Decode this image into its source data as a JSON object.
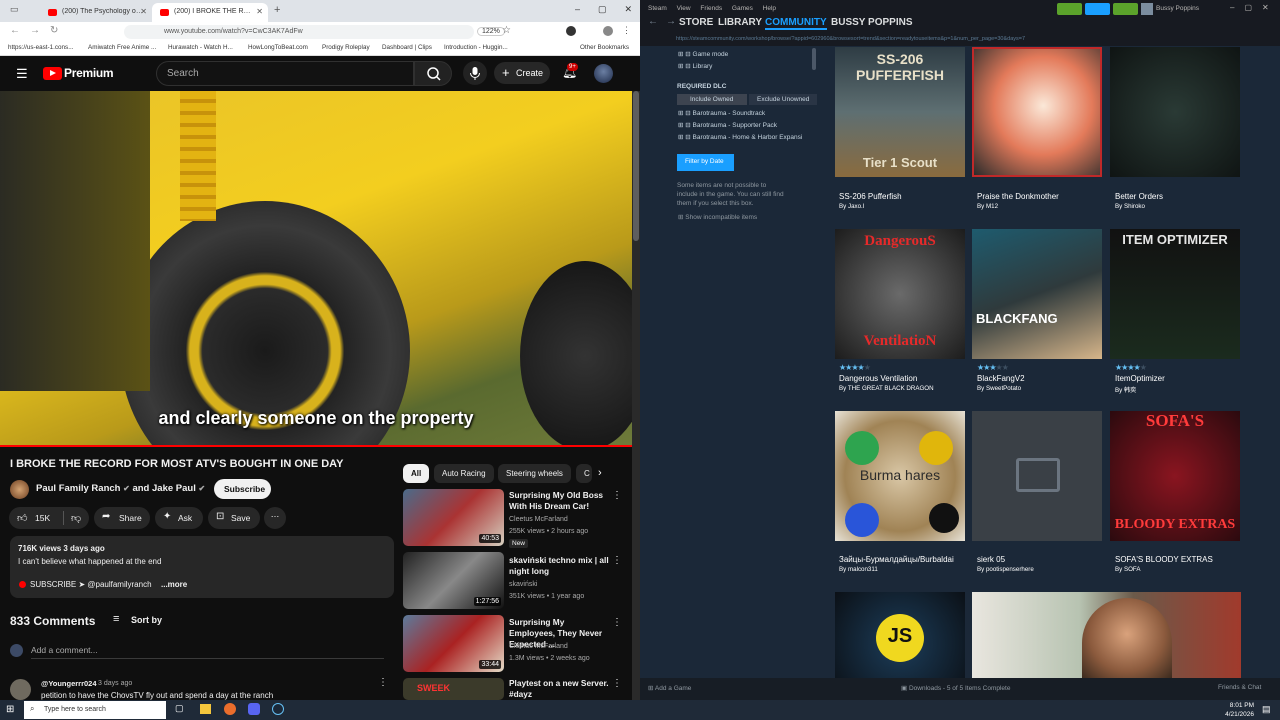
{
  "browser": {
    "tabs": [
      {
        "title": "(200) The Psychology of People"
      },
      {
        "title": "(200) I BROKE THE RECORD"
      }
    ],
    "url": "www.youtube.com/watch?v=CwC3AK7AdFw",
    "zoom": "122%",
    "bookmarks": [
      "https://us-east-1.cons...",
      "Amiwatch Free Anime ...",
      "Hurawatch - Watch H...",
      "HowLongToBeat.com",
      "Prodigy Roleplay",
      "Dashboard | Clips",
      "Introduction - Huggin...",
      "Other Bookmarks"
    ]
  },
  "youtube": {
    "logo": "Premium",
    "search_placeholder": "Search",
    "create_label": "Create",
    "notif_count": "9+",
    "caption": "and clearly someone on the property",
    "video_title": "I BROKE THE RECORD FOR MOST ATV'S BOUGHT IN ONE DAY",
    "channel": "Paul Family Ranch",
    "channel_and": "and",
    "channel2": "Jake Paul",
    "subscribe": "Subscribe",
    "likes": "15K",
    "share": "Share",
    "ask": "Ask",
    "save": "Save",
    "views": "716K views  3 days ago",
    "desc_line": "I can't believe what happened at the end",
    "desc_sub": "SUBSCRIBE ➤ @paulfamilyranch",
    "more": "...more",
    "comments_count": "833 Comments",
    "sort_by": "Sort by",
    "add_comment": "Add a comment...",
    "comment_user": "@Youngerrr024",
    "comment_time": "3 days ago",
    "comment_text": "petition to have the ChovsTV fly out and spend a day at the ranch",
    "chips": [
      "All",
      "Auto Racing",
      "Steering wheels",
      "C"
    ],
    "recs": [
      {
        "title": "Surprising My Old Boss With His Dream Car!",
        "channel": "Cleetus McFarland",
        "meta": "255K views • 2 hours ago",
        "badge": "New",
        "duration": "40:53"
      },
      {
        "title": "skaviński techno mix | all night long",
        "channel": "skaviński",
        "meta": "351K views • 1 year ago",
        "badge": "",
        "duration": "1:27:56"
      },
      {
        "title": "Surprising My Employees, They Never Expected ...",
        "channel": "Cleetus McFarland",
        "meta": "1.3M views • 2 weeks ago",
        "badge": "",
        "duration": "33:44"
      },
      {
        "title": "Playtest on a new Server. #dayz",
        "channel": "",
        "meta": "",
        "badge": "",
        "duration": ""
      }
    ],
    "rec4_thumb_text": "SWEEK"
  },
  "steam": {
    "menu": [
      "Steam",
      "View",
      "Friends",
      "Games",
      "Help"
    ],
    "nav": [
      "STORE",
      "LIBRARY",
      "COMMUNITY",
      "BUSSY POPPINS"
    ],
    "user": "Bussy Poppins",
    "url": "https://steamcommunity.com/workshop/browse/?appid=602960&browsesort=trend&section=readytouseitems&p=1&num_per_page=30&days=7",
    "sidebar": {
      "items_top": [
        "Game mode",
        "Library"
      ],
      "required_dlc": "REQUIRED DLC",
      "include_owned": "Include Owned",
      "exclude_unowned": "Exclude Unowned",
      "dlc": [
        "Barotrauma - Soundtrack",
        "Barotrauma - Supporter Pack",
        "Barotrauma - Home & Harbor Expansi"
      ],
      "filter_btn": "Filter by Date",
      "note": "Some items are not possible to include in the game. You can still find them if you select this box.",
      "show_incompat": "Show incompatible items"
    },
    "items": [
      {
        "title": "SS-206 Pufferfish",
        "by": "By",
        "author": "Jaxo.l",
        "thumb_text": "SS-206 PUFFERFISH",
        "thumb_sub": "Tier 1 Scout",
        "rating": 0
      },
      {
        "title": "Praise the Donkmother",
        "by": "By",
        "author": "M12",
        "thumb_text": "",
        "thumb_sub": "",
        "rating": 0
      },
      {
        "title": "Better Orders",
        "by": "By",
        "author": "Shiroko",
        "thumb_text": "",
        "thumb_sub": "",
        "rating": 0
      },
      {
        "title": "Dangerous Ventilation",
        "by": "By",
        "author": "THE GREAT BLACK DRAGON",
        "thumb_text": "DangerouS",
        "thumb_sub": "VentilatioN",
        "rating": 4
      },
      {
        "title": "BlackFangV2",
        "by": "By",
        "author": "SweetPotato",
        "thumb_text": "BLACKFANG",
        "thumb_sub": "",
        "rating": 3
      },
      {
        "title": "ItemOptimizer",
        "by": "By",
        "author": "韩奕",
        "thumb_text": "ITEM OPTIMIZER",
        "thumb_sub": "",
        "rating": 4
      },
      {
        "title": "Зайцы-Бурмалдайцы/Burbaldai",
        "by": "By",
        "author": "malcon311",
        "thumb_text": "Burma hares",
        "thumb_sub": "",
        "rating": 0
      },
      {
        "title": "sierk 05",
        "by": "By",
        "author": "pootispenserhere",
        "thumb_text": "",
        "thumb_sub": "",
        "rating": 0
      },
      {
        "title": "SOFA'S BLOODY EXTRAS",
        "by": "By",
        "author": "SOFA",
        "thumb_text": "SOFA'S",
        "thumb_sub": "BLOODY EXTRAS",
        "rating": 0
      },
      {
        "title": "",
        "by": "",
        "author": "",
        "thumb_text": "JS",
        "thumb_sub": "",
        "rating": 0
      }
    ],
    "add_game": "Add a Game",
    "downloads": "Downloads - 5 of 5 Items Complete",
    "friends_chat": "Friends & Chat"
  },
  "taskbar": {
    "search_placeholder": "Type here to search",
    "time": "8:01 PM",
    "date": "4/21/2026"
  },
  "colors": {
    "yt_red": "#ff0000",
    "steam_blue": "#1a9fff",
    "steam_bg": "#1b2838",
    "steam_star": "#66c0f4"
  }
}
